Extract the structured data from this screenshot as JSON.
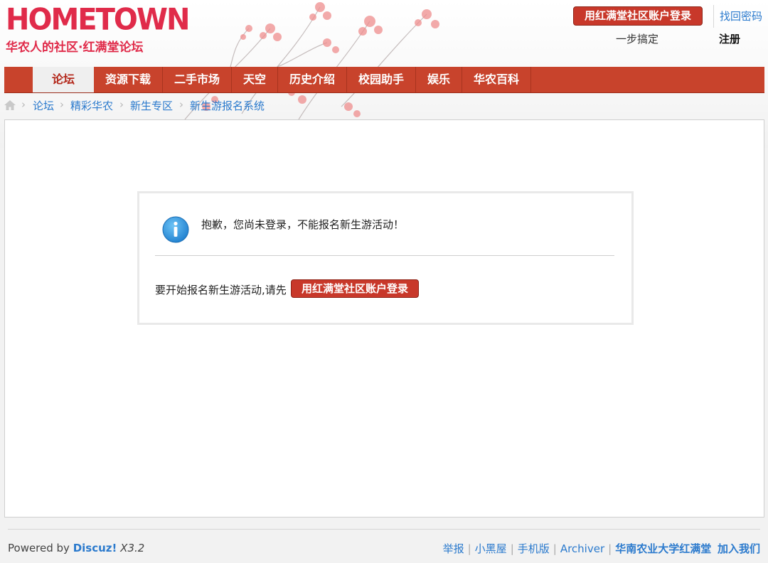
{
  "header": {
    "logo_main": "HOMETOWN",
    "logo_sub": "华农人的社区·红满堂论坛",
    "login_button": "用红满堂社区账户登录",
    "forgot_password": "找回密码",
    "one_step": "一步搞定",
    "register": "注册"
  },
  "nav": {
    "items": [
      {
        "label": "论坛"
      },
      {
        "label": "资源下载"
      },
      {
        "label": "二手市场"
      },
      {
        "label": "天空"
      },
      {
        "label": "历史介绍"
      },
      {
        "label": "校园助手"
      },
      {
        "label": "娱乐"
      },
      {
        "label": "华农百科"
      }
    ]
  },
  "breadcrumb": {
    "separator": "›",
    "items": [
      {
        "label": "论坛"
      },
      {
        "label": "精彩华农"
      },
      {
        "label": "新生专区"
      },
      {
        "label": "新生游报名系统"
      }
    ]
  },
  "message": {
    "title": "抱歉，您尚未登录，不能报名新生游活动！",
    "prompt": "要开始报名新生游活动,请先",
    "login_button": "用红满堂社区账户登录"
  },
  "footer": {
    "powered_prefix": "Powered by ",
    "brand": "Discuz!",
    "version": "X3.2",
    "links": [
      {
        "label": "举报"
      },
      {
        "label": "小黑屋"
      },
      {
        "label": "手机版"
      },
      {
        "label": "Archiver"
      },
      {
        "label": "华南农业大学红满堂"
      },
      {
        "label": "加入我们"
      }
    ]
  },
  "colors": {
    "nav_bg": "#c8432c",
    "button_red": "#c8382a",
    "link_blue": "#2b7acd",
    "logo_red": "#e02b4a",
    "info_blue": "#2f8fd6"
  },
  "icons": {
    "home": "home-icon",
    "info": "info-icon"
  }
}
